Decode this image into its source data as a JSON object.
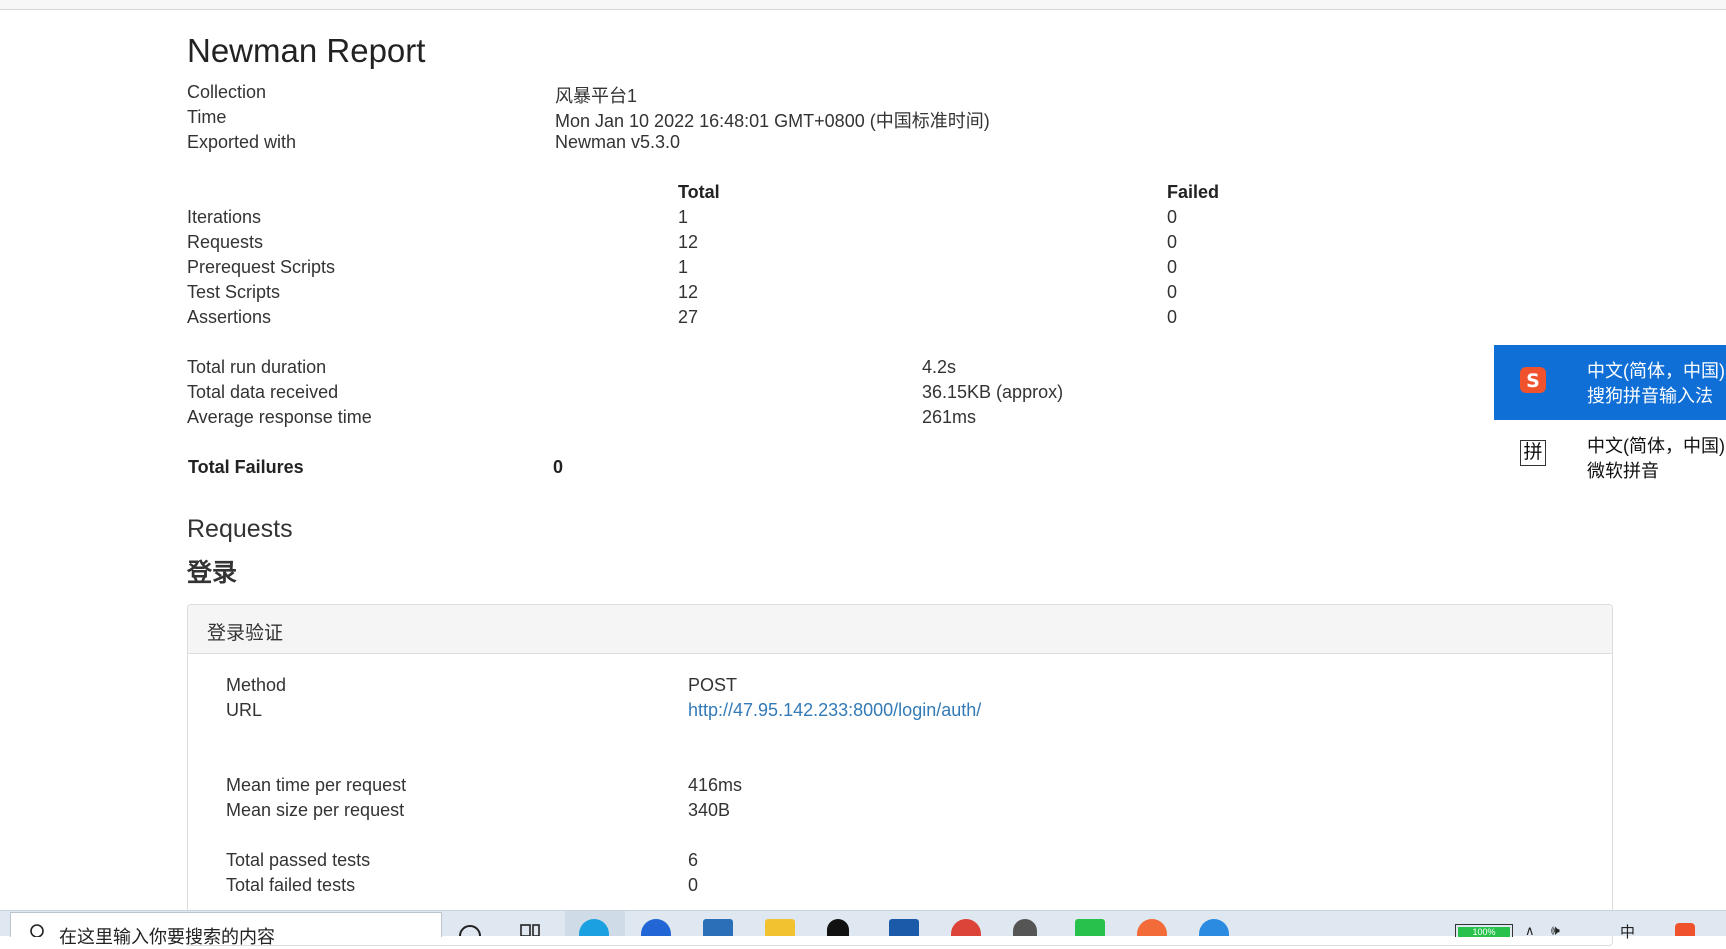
{
  "report": {
    "title": "Newman Report",
    "meta": [
      {
        "label": "Collection",
        "value": "风暴平台1"
      },
      {
        "label": "Time",
        "value": "Mon Jan 10 2022 16:48:01 GMT+0800 (中国标准时间)"
      },
      {
        "label": "Exported with",
        "value": "Newman v5.3.0"
      }
    ],
    "summary_headers": {
      "total": "Total",
      "failed": "Failed"
    },
    "summary_rows": [
      {
        "label": "Iterations",
        "total": "1",
        "failed": "0"
      },
      {
        "label": "Requests",
        "total": "12",
        "failed": "0"
      },
      {
        "label": "Prerequest Scripts",
        "total": "1",
        "failed": "0"
      },
      {
        "label": "Test Scripts",
        "total": "12",
        "failed": "0"
      },
      {
        "label": "Assertions",
        "total": "27",
        "failed": "0"
      }
    ],
    "run_stats": [
      {
        "label": "Total run duration",
        "value": "4.2s"
      },
      {
        "label": "Total data received",
        "value": "36.15KB (approx)"
      },
      {
        "label": "Average response time",
        "value": "261ms"
      }
    ],
    "total_failures": {
      "label": "Total Failures",
      "value": "0"
    },
    "requests_heading": "Requests",
    "folder_name": "登录",
    "request": {
      "name": "登录验证",
      "method_label": "Method",
      "method": "POST",
      "url_label": "URL",
      "url": "http://47.95.142.233:8000/login/auth/",
      "mean_time_label": "Mean time per request",
      "mean_time": "416ms",
      "mean_size_label": "Mean size per request",
      "mean_size": "340B",
      "passed_label": "Total passed tests",
      "passed": "6",
      "failed_label": "Total failed tests",
      "failed": "0"
    }
  },
  "ime_menu": {
    "items": [
      {
        "line1": "中文(简体，中国)",
        "line2": "搜狗拼音输入法",
        "icon": "sogou-icon",
        "active": true
      },
      {
        "line1": "中文(简体，中国)",
        "line2": "微软拼音",
        "icon_text": "拼",
        "icon": "pinyin-icon",
        "active": false
      }
    ]
  },
  "taskbar": {
    "search_placeholder": "在这里输入你要搜索的内容",
    "battery": "100%",
    "lang": "中",
    "colors": {
      "accent": "#0f6fd6",
      "link": "#337ab7"
    }
  }
}
